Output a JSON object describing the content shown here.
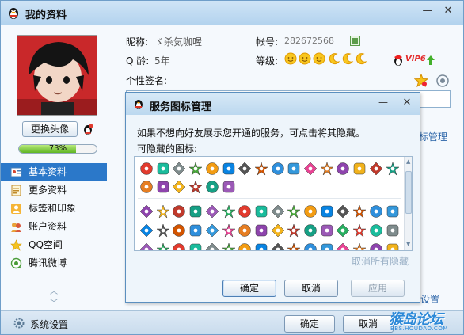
{
  "window": {
    "title": "我的资料",
    "minimize": "—",
    "close": "✕"
  },
  "profile": {
    "nickname_label": "昵称:",
    "nickname_value": "ゞ杀気咖喔",
    "qq_label": "帐号:",
    "qq_value": "282672568",
    "age_label": "Q 龄:",
    "age_value": "5年",
    "level_label": "等级:",
    "level_icons": [
      "sun",
      "sun",
      "sun",
      "moon",
      "moon",
      "moon"
    ],
    "vip_label": "VIP6",
    "signature_label": "个性签名:",
    "change_avatar": "更换头像",
    "completion_percent": 73,
    "completion_text": "73%"
  },
  "nav": {
    "items": [
      {
        "label": "基本资料",
        "icon": "profile-card-icon",
        "active": true
      },
      {
        "label": "更多资料",
        "icon": "more-info-icon",
        "active": false
      },
      {
        "label": "标签和印象",
        "icon": "tag-icon",
        "active": false
      },
      {
        "label": "账户资料",
        "icon": "account-icon",
        "active": false
      },
      {
        "label": "QQ空间",
        "icon": "qzone-icon",
        "active": false
      },
      {
        "label": "腾讯微博",
        "icon": "weibo-icon",
        "active": false
      }
    ],
    "scroll_up": "︿",
    "scroll_down": "﹀"
  },
  "behind": {
    "manage_link": "标管理",
    "settings_link": "设置"
  },
  "bottom": {
    "system_settings": "系统设置",
    "ok": "确定",
    "cancel": "取消",
    "watermark_main": "猴岛论坛",
    "watermark_sub": "BBS.HOUDAO.COM"
  },
  "dialog": {
    "title": "服务图标管理",
    "minimize": "—",
    "close": "✕",
    "description": "如果不想向好友展示您开通的服务，可点击将其隐藏。",
    "hideable_label": "可隐藏的图标:",
    "unhide_all": "取消所有隐藏",
    "ok": "确定",
    "cancel": "取消",
    "apply": "应用",
    "colors": {
      "accent": "#2b78c9",
      "title_bar": "#bcd8ef"
    }
  }
}
